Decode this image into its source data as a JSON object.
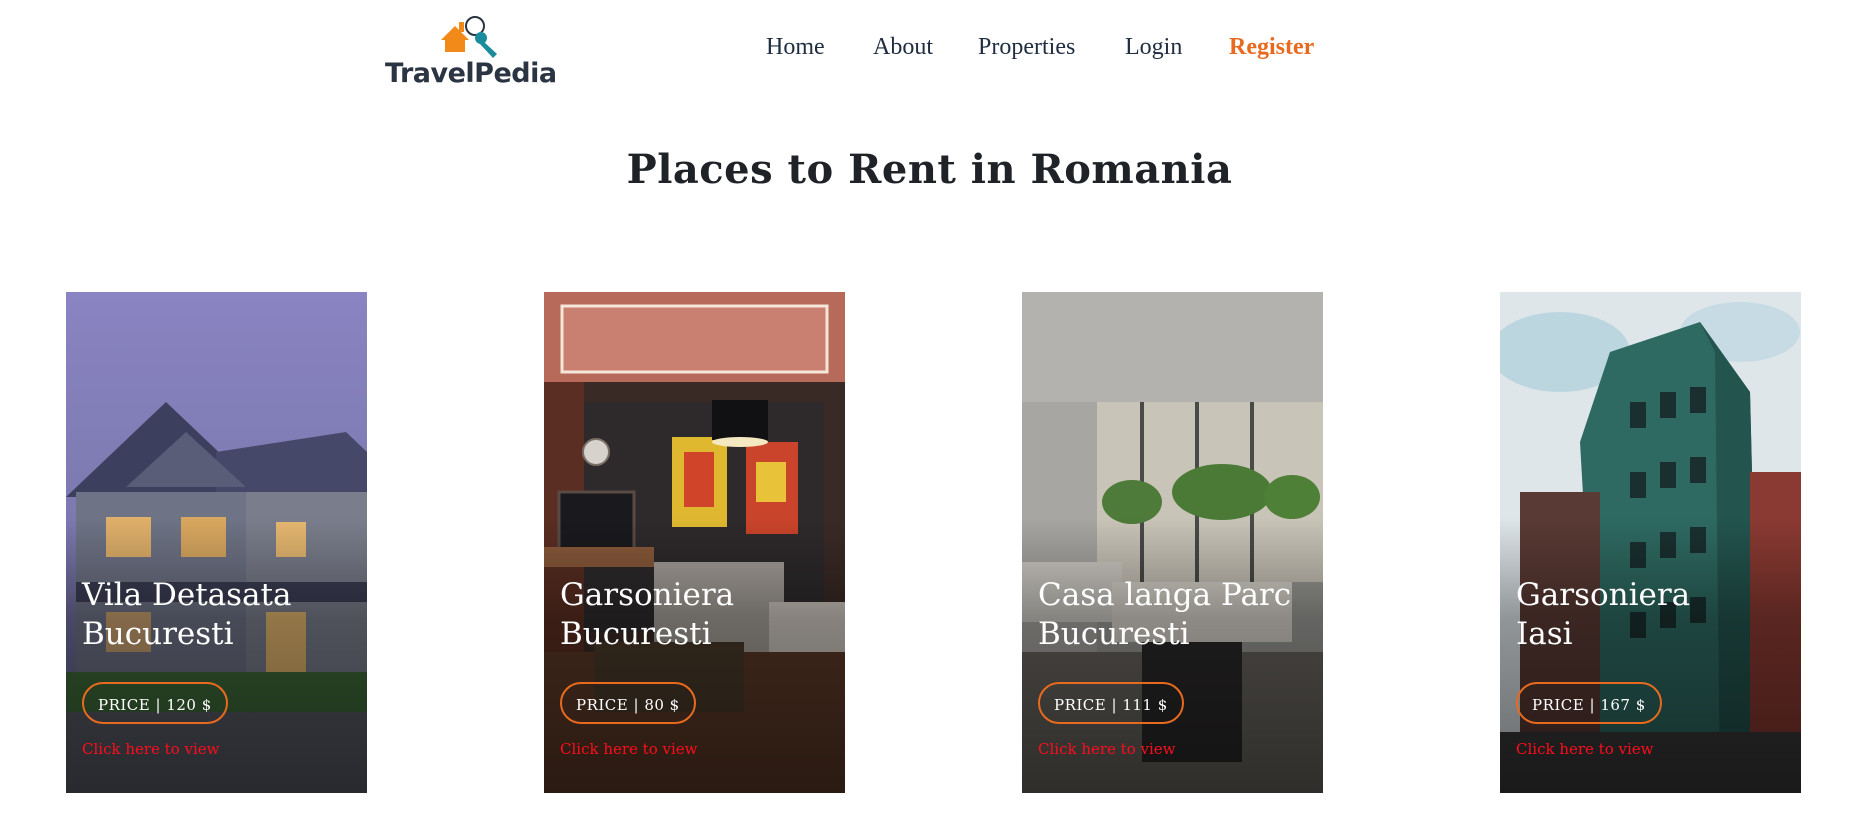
{
  "brand": {
    "name": "TravelPedia",
    "accent_color": "#e86a1e",
    "key_color": "#1a8c9c"
  },
  "nav": {
    "items": [
      {
        "label": "Home"
      },
      {
        "label": "About"
      },
      {
        "label": "Properties"
      },
      {
        "label": "Login"
      },
      {
        "label": "Register"
      }
    ]
  },
  "page_title": "Places to Rent in Romania",
  "properties": [
    {
      "title": "Vila Detasata\nBucuresti",
      "price": "PRICE | 120 $",
      "link": "Click here to view",
      "image": "suburban-house-photo"
    },
    {
      "title": "Garsoniera\nBucuresti",
      "price": "PRICE | 80 $",
      "link": "Click here to view",
      "image": "living-room-photo"
    },
    {
      "title": "Casa langa Parc\nBucuresti",
      "price": "PRICE | 111 $",
      "link": "Click here to view",
      "image": "modern-interior-photo"
    },
    {
      "title": "Garsoniera\nIasi",
      "price": "PRICE | 167 $",
      "link": "Click here to view",
      "image": "corner-building-photo"
    }
  ]
}
